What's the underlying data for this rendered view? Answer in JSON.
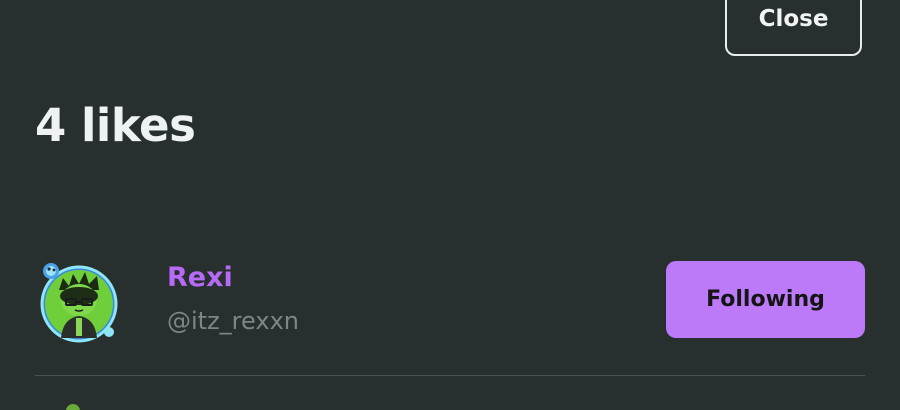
{
  "modal": {
    "close_label": "Close",
    "title": "4 likes"
  },
  "likes": [
    {
      "display_name": "Rexi",
      "handle": "@itz_rexxn",
      "follow_label": "Following"
    }
  ],
  "colors": {
    "background": "#272f2f",
    "accent": "#bc79f8",
    "name": "#b66af5",
    "handle": "#7d8686",
    "text": "#eef2f2"
  },
  "icons": {
    "avatar": "avatar-image"
  }
}
